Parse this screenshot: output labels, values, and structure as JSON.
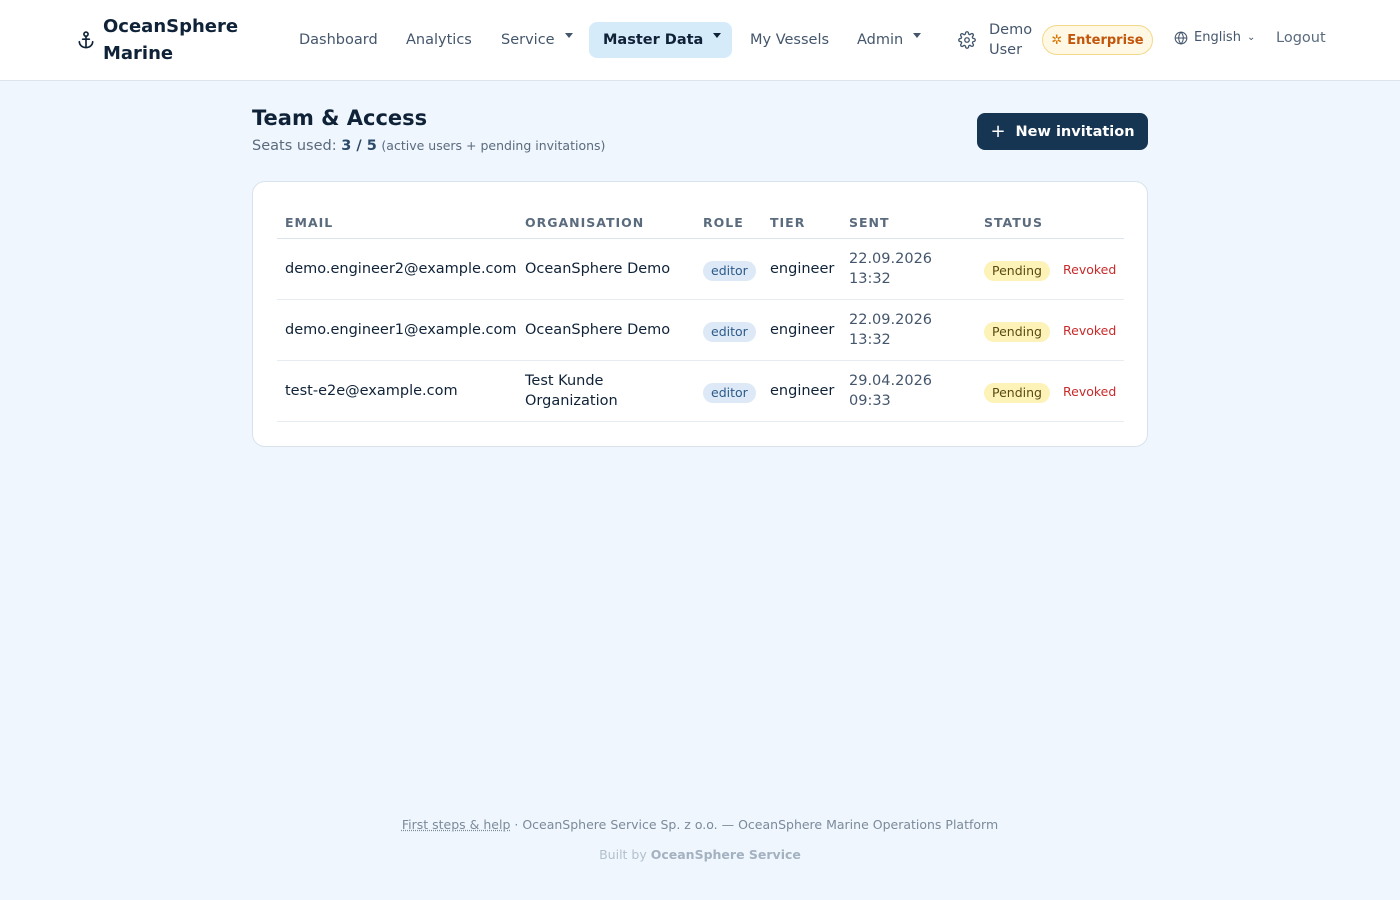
{
  "brand": {
    "name": "OceanSphere Marine",
    "icon": "anchor-icon"
  },
  "nav": {
    "items": [
      {
        "label": "Dashboard",
        "dropdown": false,
        "active": false
      },
      {
        "label": "Analytics",
        "dropdown": false,
        "active": false
      },
      {
        "label": "Service",
        "dropdown": true,
        "active": false
      },
      {
        "label": "Master Data",
        "dropdown": true,
        "active": true
      },
      {
        "label": "My Vessels",
        "dropdown": false,
        "active": false
      },
      {
        "label": "Admin",
        "dropdown": true,
        "active": false
      }
    ],
    "user": "Demo User",
    "plan": "Enterprise",
    "language": "English",
    "logout": "Logout"
  },
  "page": {
    "title": "Team & Access",
    "seats_label": "Seats used:",
    "seats_count": "3 / 5",
    "seats_hint": "(active users + pending invitations)",
    "new_invitation": "New invitation"
  },
  "table": {
    "headers": [
      "EMAIL",
      "ORGANISATION",
      "ROLE",
      "TIER",
      "SENT",
      "STATUS"
    ],
    "rows": [
      {
        "email": "demo.engineer2@example.com",
        "org": "OceanSphere Demo",
        "role": "editor",
        "tier": "engineer",
        "sent": "22.09.2026 13:32",
        "status": "Pending",
        "action": "Revoked"
      },
      {
        "email": "demo.engineer1@example.com",
        "org": "OceanSphere Demo",
        "role": "editor",
        "tier": "engineer",
        "sent": "22.09.2026 13:32",
        "status": "Pending",
        "action": "Revoked"
      },
      {
        "email": "test-e2e@example.com",
        "org": "Test Kunde Organization",
        "role": "editor",
        "tier": "engineer",
        "sent": "29.04.2026 09:33",
        "status": "Pending",
        "action": "Revoked"
      }
    ]
  },
  "footer": {
    "help": "First steps & help",
    "company": " · OceanSphere Service Sp. z o.o. — OceanSphere Marine Operations Platform",
    "built_prefix": "Built by ",
    "built_by": "OceanSphere Service"
  },
  "colors": {
    "accent": "#163552",
    "page_bg": "#eff6fd",
    "active_nav_bg": "#d6ebfa",
    "pending": "#fdf2b8",
    "revoked": "#c92a2a",
    "enterprise": "#c2570c"
  }
}
